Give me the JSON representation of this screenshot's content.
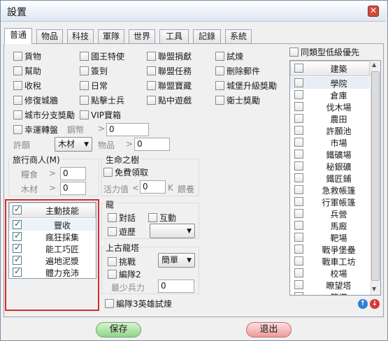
{
  "window": {
    "title": "設置",
    "close_label": "✕"
  },
  "tabs": [
    "普通",
    "物品",
    "科技",
    "軍隊",
    "世界",
    "工具",
    "記錄",
    "系統"
  ],
  "options": [
    {
      "label": "貨物",
      "checked": false
    },
    {
      "label": "國王特使",
      "checked": false
    },
    {
      "label": "聯盟捐獻",
      "checked": false
    },
    {
      "label": "試煉",
      "checked": false
    },
    {
      "label": "幫助",
      "checked": false
    },
    {
      "label": "簽到",
      "checked": false
    },
    {
      "label": "聯盟任務",
      "checked": false
    },
    {
      "label": "刪除郵件",
      "checked": false
    },
    {
      "label": "收稅",
      "checked": false
    },
    {
      "label": "日常",
      "checked": false
    },
    {
      "label": "聯盟寶藏",
      "checked": false
    },
    {
      "label": "城堡升級獎勵",
      "checked": false
    },
    {
      "label": "修復城牆",
      "checked": false
    },
    {
      "label": "點擊士兵",
      "checked": false
    },
    {
      "label": "點中遊戲",
      "checked": false
    },
    {
      "label": "衛士獎勵",
      "checked": false
    },
    {
      "label": "城市分支獎勵",
      "checked": false
    },
    {
      "label": "VIP寶箱",
      "checked": false
    }
  ],
  "lucky": {
    "label": "幸運轉盤",
    "currency_label": "鋼幣",
    "gt": ">",
    "value": "0"
  },
  "permit": {
    "label": "許願",
    "select_value": "木材",
    "item_label": "物品",
    "gt": ">",
    "value": "0"
  },
  "merchant": {
    "title": "旅行商人(M)",
    "food_label": "糧食",
    "wood_label": "木材",
    "gt": ">",
    "food_value": "0",
    "wood_value": "0"
  },
  "life_tree": {
    "title": "生命之樹",
    "free_label": "免費領取",
    "free_checked": false,
    "vitality_label": "活力值",
    "lt": "<",
    "vitality_value": "0",
    "unit_label": "K",
    "feed_label": "餵養"
  },
  "active_skills": {
    "header": "主動技能",
    "header_checked": true,
    "items": [
      {
        "label": "豐收",
        "checked": true
      },
      {
        "label": "瘋狂採集",
        "checked": true
      },
      {
        "label": "能工巧匠",
        "checked": true
      },
      {
        "label": "遍地泥漿",
        "checked": true
      },
      {
        "label": "體力充沛",
        "checked": true
      }
    ]
  },
  "dragon": {
    "title": "龍",
    "dialog_label": "對話",
    "interact_label": "互動",
    "travel_label": "遊歷",
    "travel_select": ""
  },
  "ancient": {
    "title": "上古龍塔",
    "challenge_label": "挑戰",
    "challenge_select": "簡單",
    "team2_label": "編隊2",
    "min_troops_label": "最少兵力",
    "min_troops_value": "0"
  },
  "hero_trial": {
    "label": "編隊3英雄試煉"
  },
  "low_priority": {
    "label": "同類型低級優先"
  },
  "buildings": {
    "header": "建築",
    "items": [
      "學院",
      "倉庫",
      "伐木場",
      "農田",
      "許願池",
      "市場",
      "鐵礦場",
      "秘銀礦",
      "鐵匠鋪",
      "急救帳篷",
      "行軍帳篷",
      "兵營",
      "馬廄",
      "靶場",
      "戰爭堡壘",
      "戰車工坊",
      "校場",
      "瞭望塔",
      "箭塔"
    ]
  },
  "buttons": {
    "save": "保存",
    "exit": "退出"
  },
  "colors": {
    "highlight_box": "#d22e2e",
    "save_green": "#a8e0a0",
    "exit_red": "#f0a0a0",
    "arrow_blue": "#2e7fd6",
    "arrow_red": "#d63a2e"
  }
}
